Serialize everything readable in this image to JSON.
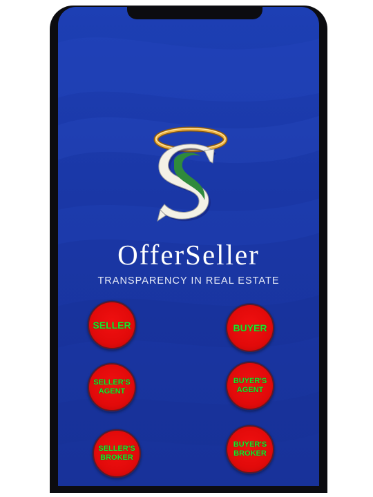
{
  "app": {
    "brand_name": "OfferSeller",
    "tagline": "TRANSPARENCY IN REAL ESTATE",
    "logo_letter": "S"
  },
  "roles": [
    {
      "label": "SELLER"
    },
    {
      "label": "BUYER"
    },
    {
      "label": "SELLER'S\nAGENT"
    },
    {
      "label": "BUYER'S\nAGENT"
    },
    {
      "label": "SELLER'S\nBROKER"
    },
    {
      "label": "BUYER'S\nBROKER"
    }
  ],
  "colors": {
    "background": "#1d3fb4",
    "button": "#e20a0a",
    "button_text": "#1ee62a",
    "halo": "#e0a42e",
    "logo_stripe": "#2f8a3c"
  },
  "icons": [
    "offerseller-logo-icon",
    "halo-icon"
  ]
}
